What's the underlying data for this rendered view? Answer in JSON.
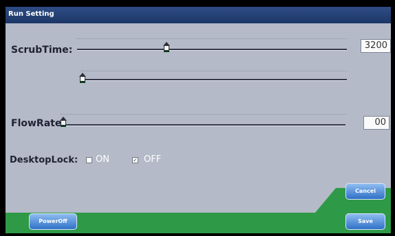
{
  "window": {
    "title": "Run Setting"
  },
  "scrub_time": {
    "label": "ScrubTime:",
    "value": "3200",
    "slider_level": 0.32,
    "sub_slider_level": 0.0
  },
  "flow_rate": {
    "label": "FlowRate:",
    "value": "00",
    "slider_level": 0.0
  },
  "desktop_lock": {
    "label": "DesktopLock:",
    "on_label": "ON",
    "off_label": "OFF",
    "on_checked": false,
    "off_checked": true
  },
  "buttons": {
    "cancel": "Cancel",
    "save": "Save",
    "power_off": "PowerOff"
  },
  "colors": {
    "title_bar": "#264273",
    "panel": "#b4bac7",
    "green_band": "#2e9a48",
    "button": "#4f8fdf"
  }
}
